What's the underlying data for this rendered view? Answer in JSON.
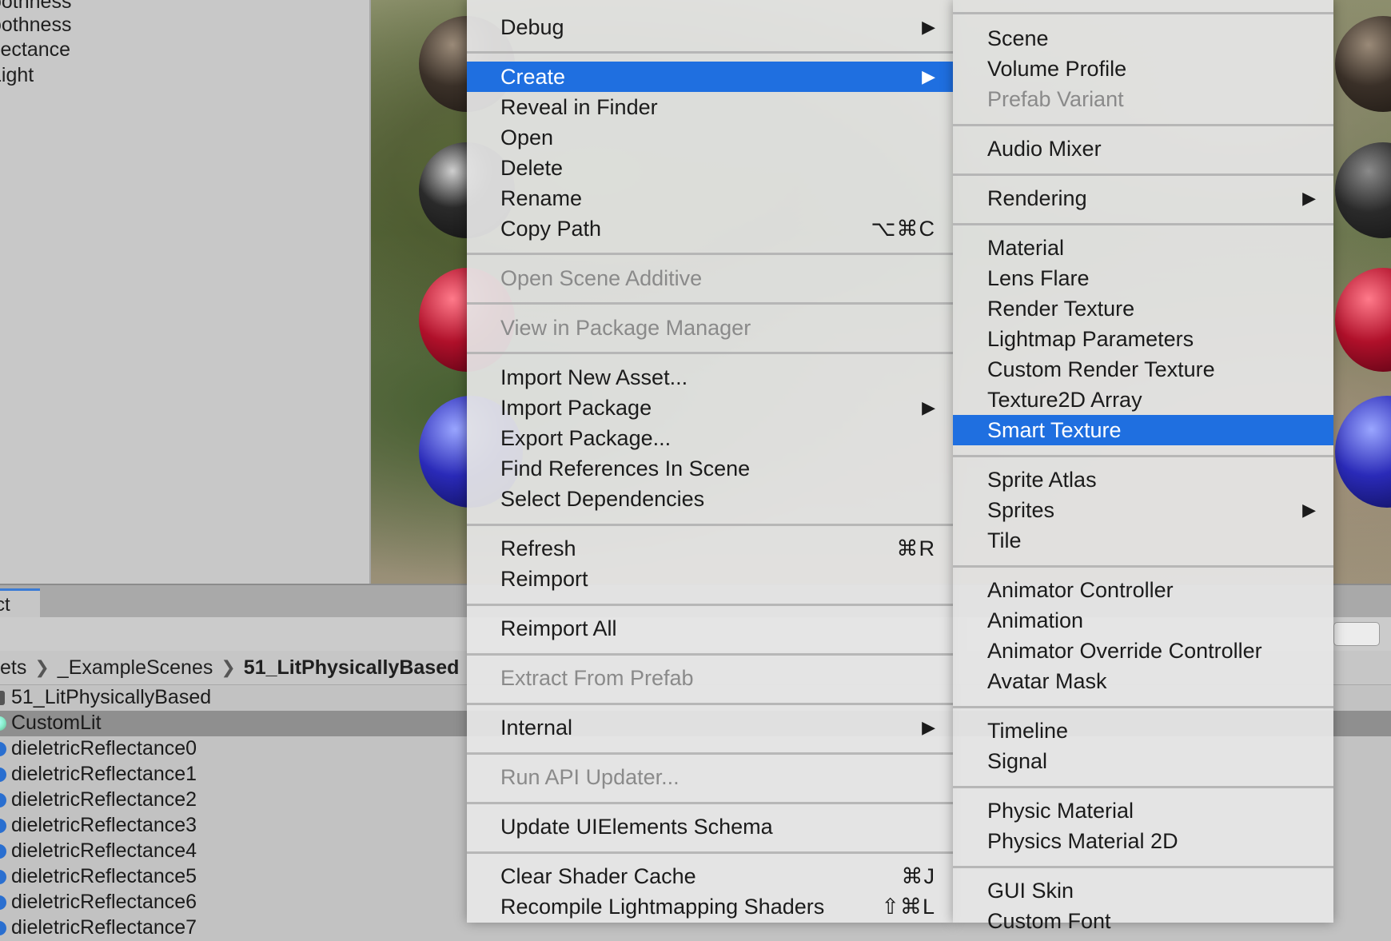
{
  "inspector": {
    "properties": [
      "oothness",
      "oothness",
      "flectance",
      "Light"
    ]
  },
  "project": {
    "tab_label": "ct",
    "breadcrumb": [
      "ets",
      "_ExampleScenes",
      "51_LitPhysicallyBased"
    ],
    "assets": [
      {
        "name": "51_LitPhysicallyBased",
        "icon": "scene-icon"
      },
      {
        "name": "CustomLit",
        "icon": "material-icon",
        "selected": true
      },
      {
        "name": "dieletricReflectance0",
        "icon": "material-icon"
      },
      {
        "name": "dieletricReflectance1",
        "icon": "material-icon"
      },
      {
        "name": "dieletricReflectance2",
        "icon": "material-icon"
      },
      {
        "name": "dieletricReflectance3",
        "icon": "material-icon"
      },
      {
        "name": "dieletricReflectance4",
        "icon": "material-icon"
      },
      {
        "name": "dieletricReflectance5",
        "icon": "material-icon"
      },
      {
        "name": "dieletricReflectance6",
        "icon": "material-icon"
      },
      {
        "name": "dieletricReflectance7",
        "icon": "material-icon"
      }
    ]
  },
  "context_menu": {
    "debug": "Debug",
    "create": "Create",
    "reveal_in_finder": "Reveal in Finder",
    "open": "Open",
    "delete": "Delete",
    "rename": "Rename",
    "copy_path": "Copy Path",
    "copy_path_shortcut": "⌥⌘C",
    "open_scene_additive": "Open Scene Additive",
    "view_in_package_manager": "View in Package Manager",
    "import_new_asset": "Import New Asset...",
    "import_package": "Import Package",
    "export_package": "Export Package...",
    "find_references_in_scene": "Find References In Scene",
    "select_dependencies": "Select Dependencies",
    "refresh": "Refresh",
    "refresh_shortcut": "⌘R",
    "reimport": "Reimport",
    "reimport_all": "Reimport All",
    "extract_from_prefab": "Extract From Prefab",
    "internal": "Internal",
    "run_api_updater": "Run API Updater...",
    "update_uielements_schema": "Update UIElements Schema",
    "clear_shader_cache": "Clear Shader Cache",
    "clear_shader_cache_shortcut": "⌘J",
    "recompile_lightmapping_shaders": "Recompile Lightmapping Shaders",
    "recompile_lightmapping_shaders_shortcut": "⇧⌘L"
  },
  "create_submenu": {
    "scene": "Scene",
    "volume_profile": "Volume Profile",
    "prefab_variant": "Prefab Variant",
    "audio_mixer": "Audio Mixer",
    "rendering": "Rendering",
    "material": "Material",
    "lens_flare": "Lens Flare",
    "render_texture": "Render Texture",
    "lightmap_parameters": "Lightmap Parameters",
    "custom_render_texture": "Custom Render Texture",
    "texture2d_array": "Texture2D Array",
    "smart_texture": "Smart Texture",
    "sprite_atlas": "Sprite Atlas",
    "sprites": "Sprites",
    "tile": "Tile",
    "animator_controller": "Animator Controller",
    "animation": "Animation",
    "animator_override_controller": "Animator Override Controller",
    "avatar_mask": "Avatar Mask",
    "timeline": "Timeline",
    "signal": "Signal",
    "physic_material": "Physic Material",
    "physics_material_2d": "Physics Material 2D",
    "gui_skin": "GUI Skin",
    "custom_font": "Custom Font"
  },
  "colors": {
    "highlight": "#1f6fe0",
    "disabled_text": "#8a8a8a"
  },
  "icons": {
    "submenu_arrow": "submenu-arrow-icon",
    "breadcrumb_separator": "chevron-right-icon"
  }
}
